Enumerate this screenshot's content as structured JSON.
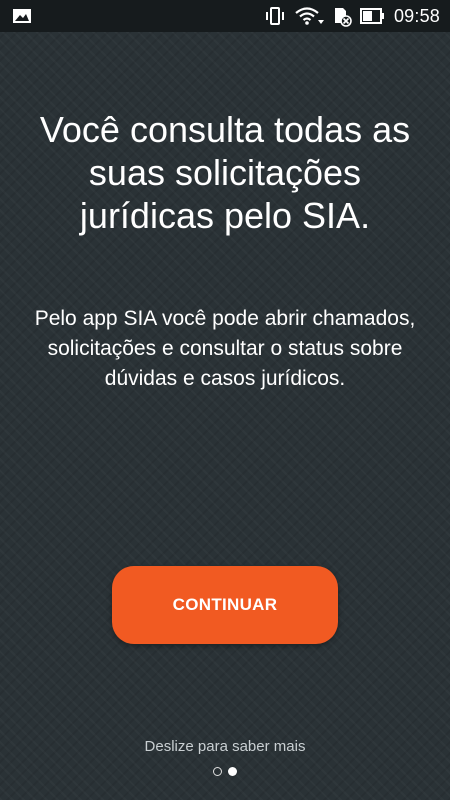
{
  "status_bar": {
    "time": "09:58",
    "icons": [
      "image-notification-icon",
      "vibrate-icon",
      "wifi-icon",
      "sd-card-icon",
      "battery-icon"
    ]
  },
  "onboarding": {
    "headline": "Você consulta todas as suas solicitações jurídicas pelo SIA.",
    "description": "Pelo app SIA você pode abrir chamados, solicitações e consultar o status sobre dúvidas e casos jurídicos.",
    "continue_label": "CONTINUAR",
    "swipe_hint": "Deslize para saber mais",
    "page_indicator": {
      "current": 2,
      "total": 2
    }
  },
  "colors": {
    "background": "#2a3236",
    "status_bar": "#161b1d",
    "accent": "#f15a22"
  }
}
